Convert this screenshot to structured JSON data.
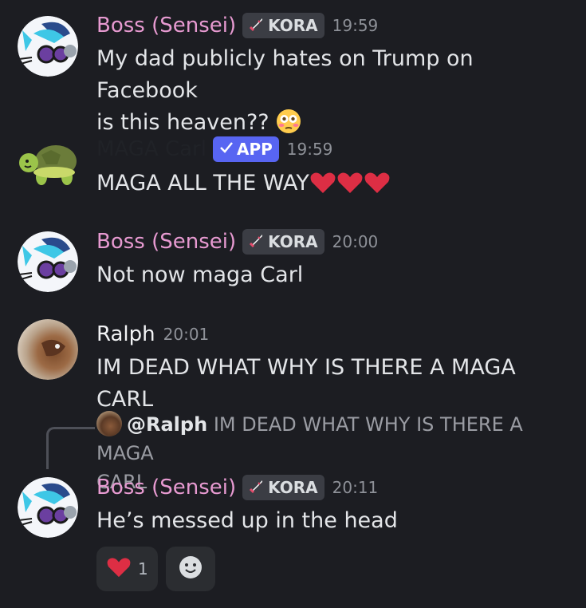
{
  "colors": {
    "background": "#1c1d22",
    "boss_name": "#e79ad1",
    "carl_name": "#1c1d22",
    "ralph_name": "#f2f3f5",
    "app_badge": "#5865f2"
  },
  "messages": [
    {
      "author": "Boss (Sensei)",
      "tag": "KORA",
      "time": "19:59",
      "lines": [
        "My dad publicly hates on Trump on Facebook",
        "is this heaven??"
      ]
    },
    {
      "author": "MAGA Carl",
      "tag": "APP",
      "time": "19:59",
      "lines": [
        "MAGA ALL THE WAY"
      ]
    },
    {
      "author": "Boss (Sensei)",
      "tag": "KORA",
      "time": "20:00",
      "lines": [
        "Not now maga Carl"
      ]
    },
    {
      "author": "Ralph",
      "time": "20:01",
      "lines": [
        "IM DEAD WHAT WHY IS THERE A MAGA CARL"
      ]
    },
    {
      "author": "Boss (Sensei)",
      "tag": "KORA",
      "time": "20:11",
      "reply": {
        "mention": "@Ralph",
        "text": "IM DEAD WHAT WHY IS THERE A MAGA",
        "text2": "CARL"
      },
      "lines": [
        "He’s messed up in the head"
      ],
      "reactions": [
        {
          "emoji": "red-heart",
          "count": "1"
        }
      ]
    }
  ],
  "icons": {
    "badge": "sword-icon",
    "app_check": "check-icon",
    "flushed": "flushed-face-emoji",
    "heart": "red-heart-emoji",
    "add_reaction": "add-reaction-icon"
  }
}
